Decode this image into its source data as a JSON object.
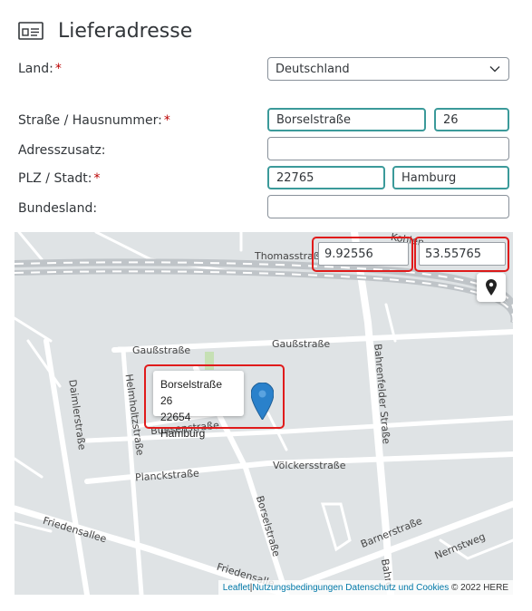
{
  "header": {
    "title": "Lieferadresse",
    "icon": "address-card-icon"
  },
  "form": {
    "country": {
      "label": "Land:",
      "value": "Deutschland"
    },
    "street": {
      "label": "Straße / Hausnummer:",
      "street_value": "Borselstraße",
      "number_value": "26"
    },
    "address_extra": {
      "label": "Adresszusatz:",
      "value": ""
    },
    "postal_city": {
      "label": "PLZ / Stadt:",
      "postal_value": "22765",
      "city_value": "Hamburg"
    },
    "state": {
      "label": "Bundesland:",
      "value": ""
    },
    "required_marker": "*"
  },
  "map": {
    "longitude": "9.92556",
    "latitude": "53.55765",
    "popup": {
      "line1": "Borselstraße 26",
      "line2": "22654 Hamburg"
    },
    "streets": {
      "thomasstr": "Thomasstraß",
      "kohlen": "Kohlen",
      "gauss1": "Gaußstraße",
      "gauss2": "Gaußstraße",
      "bahrenfelder": "Bahrenfelder Straße",
      "helmholtz": "Helmholtzstraße",
      "daimler": "Daimlerstraße",
      "bunsen": "Bunsenstraße",
      "planck": "Planckstraße",
      "voelckers": "Völckersstraße",
      "friedensallee1": "Friedensallee",
      "friedensallee2": "Friedensalle",
      "borsel": "Borselstraße",
      "barner": "Barnerstraße",
      "nernst": "Nernstweg",
      "bahre": "Bahre"
    },
    "attribution": {
      "leaflet": "Leaflet",
      "sep": " | ",
      "terms": "Nutzungsbedingungen",
      "privacy": "Datenschutz und Cookies",
      "copyright": "© 2022 HERE"
    }
  },
  "colors": {
    "accent_border": "#3b9a9a",
    "highlight": "#e01b1b",
    "required": "#bb0000",
    "pin": "#2a81cb"
  }
}
